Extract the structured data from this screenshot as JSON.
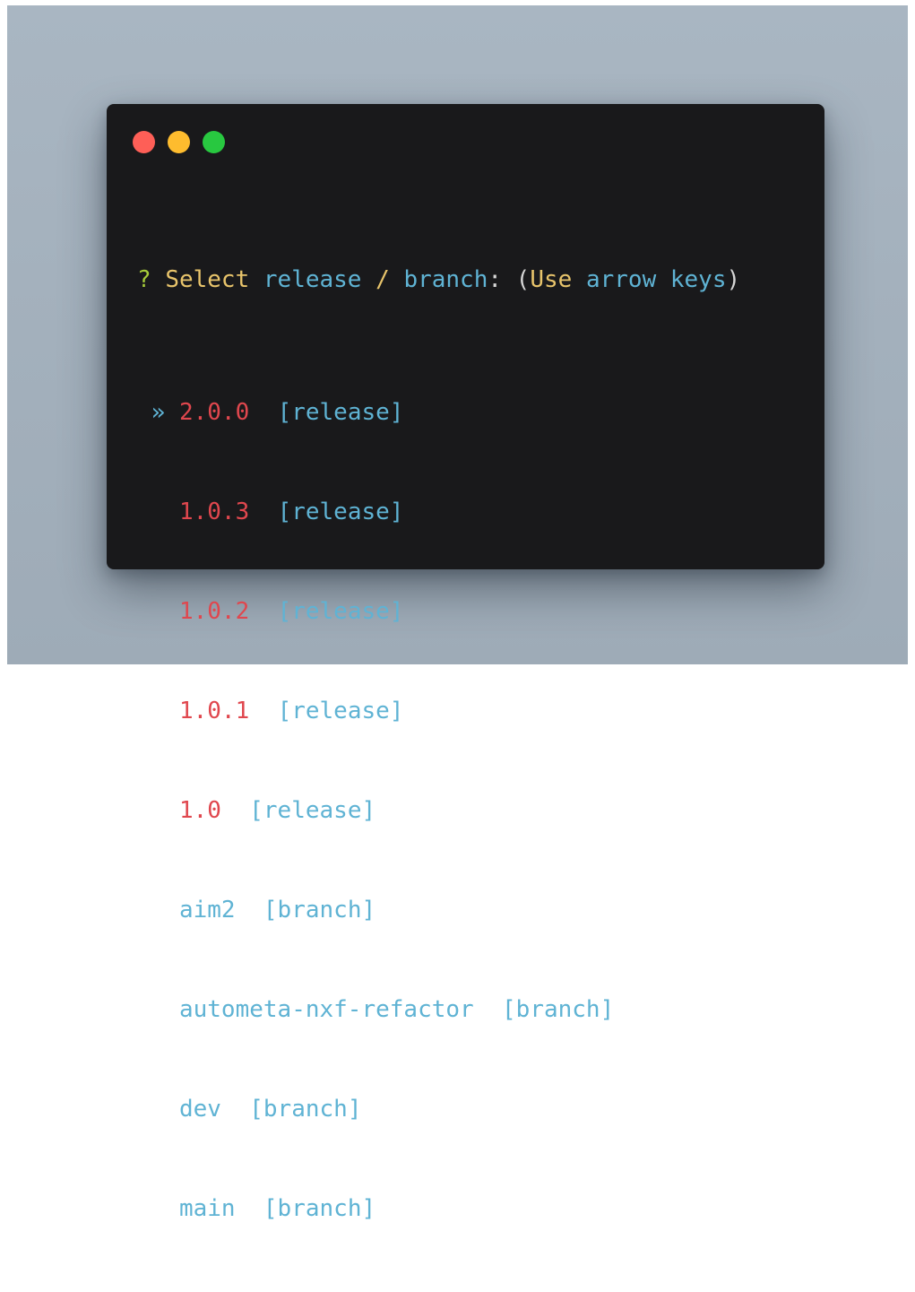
{
  "colors": {
    "background": "#a3b0bc",
    "window": "#19191b",
    "close": "#fe5f57",
    "minimize": "#febc2e",
    "maximize": "#28c840",
    "release_version": "#e0474e",
    "branch_name": "#5fb3d4",
    "prompt_mark": "#a6cc3a",
    "keyword": "#e8c46b"
  },
  "prompt": {
    "mark": "?",
    "select": "Select",
    "release": "release",
    "slash": "/",
    "branch": "branch",
    "colon": ":",
    "open_paren": "(",
    "use": "Use",
    "arrow_keys": "arrow keys",
    "close_paren": ")"
  },
  "pointer": "»",
  "options": [
    {
      "name": "2.0.0",
      "tag": "[release]",
      "kind": "release",
      "selected": true
    },
    {
      "name": "1.0.3",
      "tag": "[release]",
      "kind": "release",
      "selected": false
    },
    {
      "name": "1.0.2",
      "tag": "[release]",
      "kind": "release",
      "selected": false
    },
    {
      "name": "1.0.1",
      "tag": "[release]",
      "kind": "release",
      "selected": false
    },
    {
      "name": "1.0",
      "tag": "[release]",
      "kind": "release",
      "selected": false
    },
    {
      "name": "aim2",
      "tag": "[branch]",
      "kind": "branch",
      "selected": false
    },
    {
      "name": "autometa-nxf-refactor",
      "tag": "[branch]",
      "kind": "branch",
      "selected": false
    },
    {
      "name": "dev",
      "tag": "[branch]",
      "kind": "branch",
      "selected": false
    },
    {
      "name": "main",
      "tag": "[branch]",
      "kind": "branch",
      "selected": false
    }
  ]
}
